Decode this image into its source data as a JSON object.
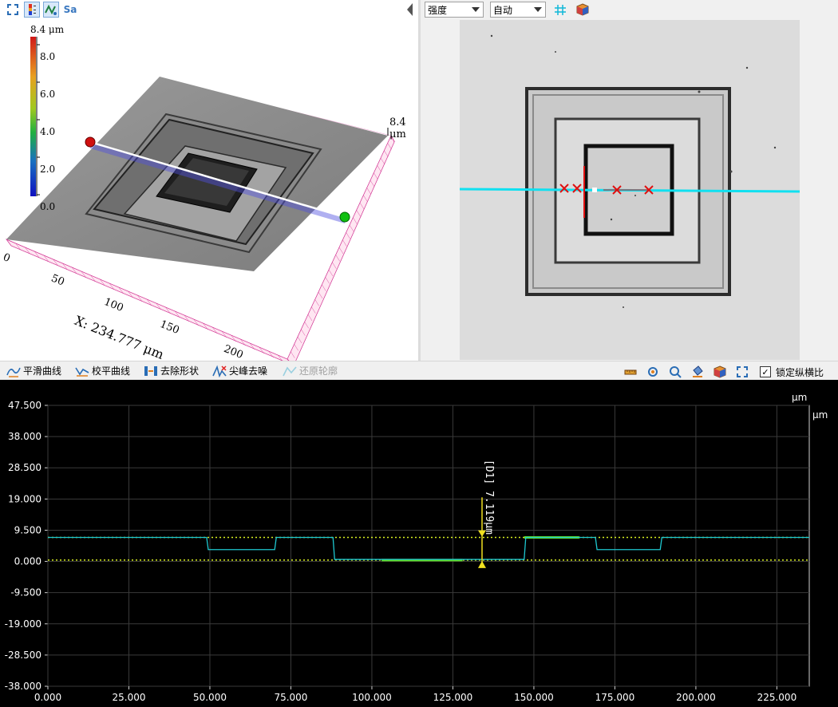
{
  "left_view": {
    "colorbar": {
      "top_label": "8.4 μm",
      "ticks": [
        "8.0",
        "6.0",
        "4.0",
        "2.0",
        "0.0"
      ]
    },
    "z_axis_label": "8.4 μm",
    "x_ticks": [
      "0",
      "50",
      "100",
      "150",
      "200"
    ],
    "x_axis_label": "X: 234.777 μm",
    "marker_start_color": "#d01010",
    "marker_end_color": "#10c010"
  },
  "right_view": {
    "mode_select": "强度",
    "auto_select": "自动"
  },
  "profile_toolbar": {
    "smooth": "平滑曲线",
    "level": "校平曲线",
    "remove_shape": "去除形状",
    "spike_denoise": "尖峰去噪",
    "restore": "还原轮廓",
    "lock_aspect": "锁定纵横比",
    "lock_aspect_checked": true
  },
  "chart_data": {
    "type": "line",
    "title": "",
    "xlabel": "",
    "ylabel": "",
    "unit_top": "μm",
    "unit_right": "μm",
    "xlim": [
      0,
      235
    ],
    "ylim": [
      -38,
      47.5
    ],
    "x_ticks": [
      "0.000",
      "25.000",
      "50.000",
      "75.000",
      "100.000",
      "125.000",
      "150.000",
      "175.000",
      "200.000",
      "225.000"
    ],
    "y_ticks": [
      "47.500",
      "38.000",
      "28.500",
      "19.000",
      "9.500",
      "0.000",
      "-9.500",
      "-19.000",
      "-28.500",
      "-38.000"
    ],
    "series": [
      {
        "color": "#1ec8d0",
        "x": [
          0,
          49,
          49.5,
          70,
          70.5,
          88,
          88.5,
          147,
          147.5,
          169,
          169.5,
          189,
          189.5,
          235
        ],
        "y": [
          7.3,
          7.3,
          3.6,
          3.6,
          7.3,
          7.3,
          0.6,
          0.6,
          7.3,
          7.3,
          3.6,
          3.6,
          7.3,
          7.3
        ]
      }
    ],
    "reference_lines": [
      7.3,
      0.4
    ],
    "annotation": {
      "label": "[D1] 7.119μm",
      "x": 134,
      "y_top": 7.5,
      "y_bottom": 0.4
    }
  }
}
